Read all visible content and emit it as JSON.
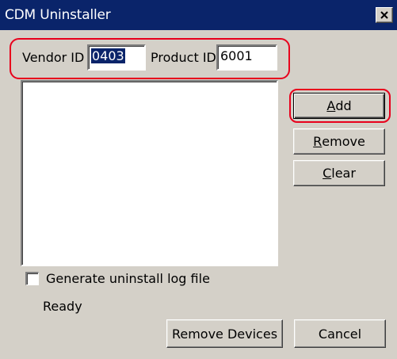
{
  "window": {
    "title": "CDM Uninstaller"
  },
  "ids": {
    "vendor_label": "Vendor ID",
    "vendor_value": "0403",
    "product_label": "Product ID",
    "product_value": "6001"
  },
  "buttons": {
    "add_label_mnemonic": "A",
    "add_label_rest": "dd",
    "remove_label_mnemonic": "R",
    "remove_label_rest": "emove",
    "clear_label_mnemonic": "C",
    "clear_label_rest": "lear",
    "remove_devices_label": "Remove Devices",
    "cancel_label": "Cancel"
  },
  "options": {
    "log_checkbox_label": "Generate uninstall log file",
    "log_checked": false
  },
  "status": {
    "text": "Ready"
  },
  "device_list": [],
  "colors": {
    "titlebar": "#0a246a",
    "dialog_face": "#d4d0c8",
    "annotation_outline": "#e8001c"
  },
  "icons": [
    "close-icon"
  ]
}
